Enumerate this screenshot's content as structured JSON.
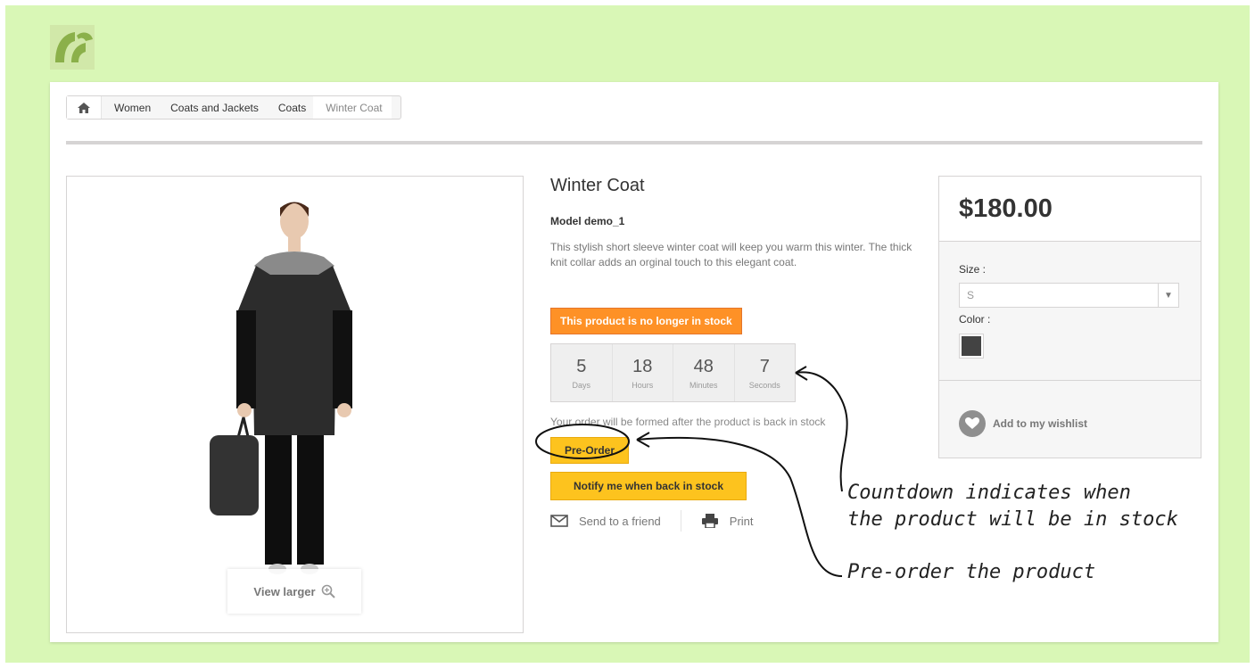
{
  "breadcrumb": {
    "items": [
      "Women",
      "Coats and Jackets",
      "Coats"
    ],
    "current": "Winter Coat"
  },
  "product": {
    "title": "Winter Coat",
    "model": "Model demo_1",
    "description": "This stylish short sleeve winter coat will keep you warm this winter. The thick knit collar adds an orginal touch to this elegant coat.",
    "out_of_stock": "This product is no longer in stock",
    "order_note": "Your order will be formed after the product is back in stock",
    "preorder_label": "Pre-Order",
    "notify_label": "Notify me when back in stock",
    "send_friend": "Send to a friend",
    "print": "Print",
    "view_larger": "View larger"
  },
  "countdown": [
    {
      "value": "5",
      "label": "Days"
    },
    {
      "value": "18",
      "label": "Hours"
    },
    {
      "value": "48",
      "label": "Minutes"
    },
    {
      "value": "7",
      "label": "Seconds"
    }
  ],
  "price_box": {
    "price": "$180.00",
    "size_label": "Size :",
    "size_value": "S",
    "color_label": "Color :",
    "color_swatch": "#434343",
    "wishlist": "Add to my wishlist"
  },
  "annotations": {
    "countdown_line1": "Countdown indicates when",
    "countdown_line2": "the product will be in stock",
    "preorder": "Pre-order the product"
  },
  "colors": {
    "background": "#d9f7b6",
    "out_of_stock": "#fe9126",
    "button_yellow": "#fdc31e"
  }
}
